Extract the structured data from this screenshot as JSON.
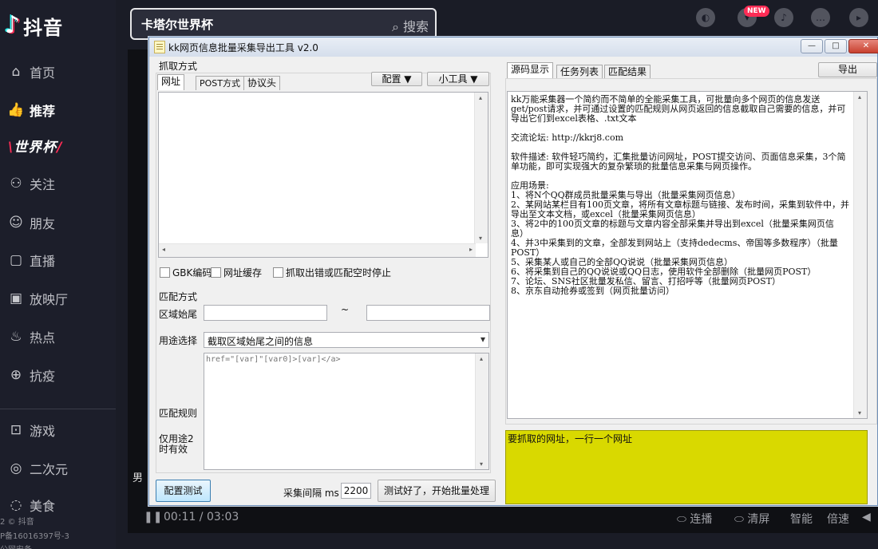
{
  "douyin": {
    "logo_text": "抖音",
    "search": {
      "value": "卡塔尔世界杯",
      "button": "搜索"
    },
    "nav": [
      {
        "label": "首页",
        "icon": "home-icon"
      },
      {
        "label": "推荐",
        "icon": "thumb-icon",
        "active": true
      },
      {
        "label": "关注",
        "icon": "user-plus-icon"
      },
      {
        "label": "朋友",
        "icon": "friends-icon"
      },
      {
        "label": "直播",
        "icon": "live-icon"
      },
      {
        "label": "放映厅",
        "icon": "tv-icon"
      },
      {
        "label": "热点",
        "icon": "fire-icon"
      },
      {
        "label": "抗疫",
        "icon": "shield-plus-icon"
      },
      {
        "label": "游戏",
        "icon": "gamepad-icon"
      },
      {
        "label": "二次元",
        "icon": "anime-icon"
      },
      {
        "label": "美食",
        "icon": "food-icon"
      }
    ],
    "worldcup_prefix": "世界杯",
    "worldcup_badge": "",
    "top_actions": [
      {
        "label": "合作",
        "icon": "cooperate-icon"
      },
      {
        "label": "客户端",
        "icon": "download-icon"
      },
      {
        "label": "通知",
        "icon": "bell-icon"
      },
      {
        "label": "私信",
        "icon": "message-icon"
      },
      {
        "label": "投稿",
        "icon": "upload-icon"
      }
    ],
    "new_badge": "NEW",
    "footer": [
      "2 © 抖音",
      "P备16016397号-3",
      "公网安备"
    ],
    "player": {
      "time": "00:11 / 03:03",
      "connect": "连播",
      "clear": "清屏",
      "smart": "智能",
      "speed": "倍速",
      "partial_left": "男"
    }
  },
  "app": {
    "title": "kk网页信息批量采集导出工具 v2.0",
    "window_buttons": {
      "minimize": "—",
      "maximize": "□",
      "close": "✕"
    },
    "fetch_group_label": "抓取方式",
    "tabs_left": [
      "网址",
      "POST方式",
      "协议头"
    ],
    "config_button": "配置 ▼",
    "tools_button": "小工具 ▼",
    "url_input_value": "",
    "checkboxes": [
      {
        "label": "GBK编码",
        "checked": false
      },
      {
        "label": "网址缓存",
        "checked": false
      },
      {
        "label": "抓取出错或匹配空时停止",
        "checked": false
      }
    ],
    "match_group_label": "匹配方式",
    "range_label": "区域始尾",
    "range_start": "",
    "range_tilde": "~",
    "range_end": "",
    "usage_label": "用途选择",
    "usage_value": "截取区域始尾之间的信息",
    "rule_label": "匹配规则",
    "rule_note": "仅用途2时有效",
    "rule_value": "href=\"[var]\"[var0]>[var]</a>",
    "test_button": "配置测试",
    "interval_label": "采集间隔 ms",
    "interval_value": "2200",
    "start_button": "测试好了，开始批量处理",
    "tabs_right": [
      "源码显示",
      "任务列表",
      "匹配结果"
    ],
    "export_button": "导出",
    "source_text": "kk万能采集器一个简约而不简单的全能采集工具，可批量向多个网页的信息发送get/post请求，并可通过设置的匹配规则从网页返回的信息截取自己需要的信息，并可导出它们到excel表格、.txt文本\n\n交流论坛: http://kkrj8.com\n\n软件描述: 软件轻巧简约，汇集批量访问网址，POST提交访问、页面信息采集，3个简单功能，即可实现强大的复杂繁琐的批量信息采集与网页操作。\n\n应用场景:\n1、将N个QQ群成员批量采集与导出（批量采集网页信息）\n2、某网站某栏目有100页文章，将所有文章标题与链接、发布时间，采集到软件中，并导出至文本文档，或excel（批量采集网页信息）\n3、将2中的100页文章的标题与文章内容全部采集并导出到excel（批量采集网页信息）\n4、并3中采集到的文章，全部发到网站上（支持dedecms、帝国等多数程序）（批量POST）\n5、采集某人或自己的全部QQ说说（批量采集网页信息）\n6、将采集到自己的QQ说说或QQ日志，使用软件全部删除（批量网页POST）\n7、论坛、SNS社区批量发私信、留言、打招呼等（批量网页POST）\n8、京东自动抢券或签到（网页批量访问）",
    "hint_text": "要抓取的网址，一行一个网址"
  }
}
